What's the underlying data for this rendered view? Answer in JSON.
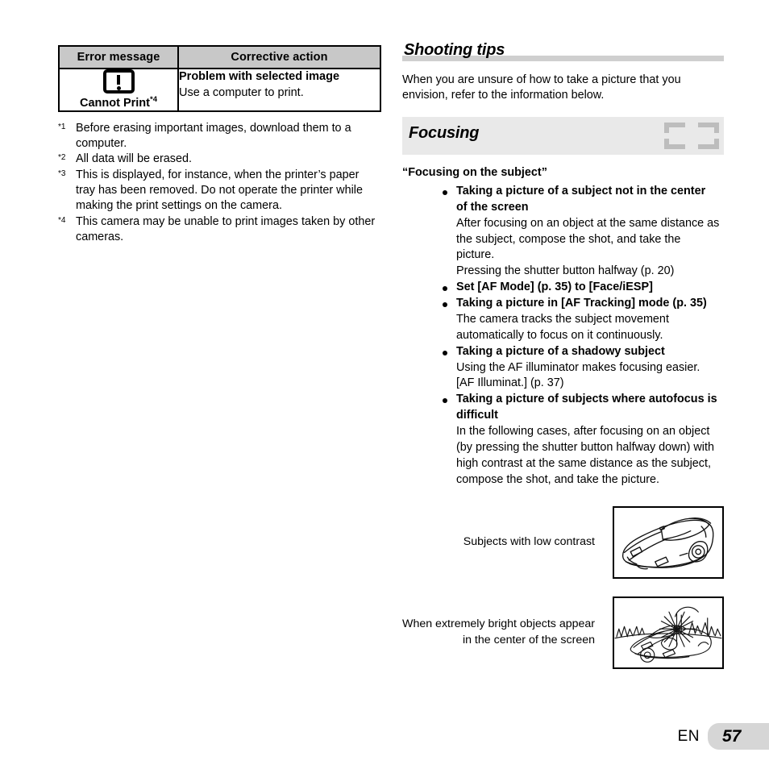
{
  "left": {
    "table": {
      "headers": [
        "Error message",
        "Corrective action"
      ],
      "row": {
        "icon_name": "warning-exclamation-icon",
        "error_label": "Cannot Print",
        "error_label_sup": "*4",
        "action_title": "Problem with selected image",
        "action_body": "Use a computer to print."
      }
    },
    "footnotes": [
      {
        "mark": "*1",
        "text": "Before erasing important images, download them to a computer."
      },
      {
        "mark": "*2",
        "text": "All data will be erased."
      },
      {
        "mark": "*3",
        "text": "This is displayed, for instance, when the printer’s paper tray has been removed. Do not operate the printer while making the print settings on the camera."
      },
      {
        "mark": "*4",
        "text": "This camera may be unable to print images taken by other cameras."
      }
    ]
  },
  "right": {
    "section_title": "Shooting tips",
    "intro": "When you are unsure of how to take a picture that you envision, refer to the information below.",
    "band": {
      "title": "Focusing",
      "icon_name": "af-frame-icon"
    },
    "quoted_heading": "“Focusing on the subject”",
    "bullets": [
      {
        "title": "Taking a picture of a subject not in the center of the screen",
        "body": [
          "After focusing on an object at the same distance as the subject, compose the shot, and take the picture.",
          "Pressing the shutter button halfway (p. 20)"
        ]
      },
      {
        "title": "Set [AF Mode] (p. 35) to [Face/iESP]",
        "body": []
      },
      {
        "title": "Taking a picture in [AF Tracking] mode (p. 35)",
        "body": [
          "The camera tracks the subject movement automatically to focus on it continuously."
        ]
      },
      {
        "title": "Taking a picture of a shadowy subject",
        "body": [
          "Using the AF illuminator makes focusing easier.",
          "[AF Illuminat.] (p. 37)"
        ]
      },
      {
        "title": "Taking a picture of subjects where autofocus is difficult",
        "body": [
          "In the following cases, after focusing on an object (by pressing the shutter button halfway down) with high contrast at the same distance as the subject, compose the shot, and take the picture."
        ]
      }
    ],
    "illustrations": [
      {
        "caption": "Subjects with low contrast",
        "image_name": "car-line-drawing"
      },
      {
        "caption": "When extremely bright objects appear in the center of the screen",
        "image_name": "car-with-sun-flare-line-drawing"
      }
    ]
  },
  "footer": {
    "language": "EN",
    "page_number": "57"
  },
  "colors": {
    "table_header_gray": "#c8c8c8",
    "rule_gray": "#cfcfcf",
    "band_gray": "#e9e9e9",
    "af_icon_gray": "#bdbdbd",
    "page_box_gray": "#d6d6d6"
  }
}
